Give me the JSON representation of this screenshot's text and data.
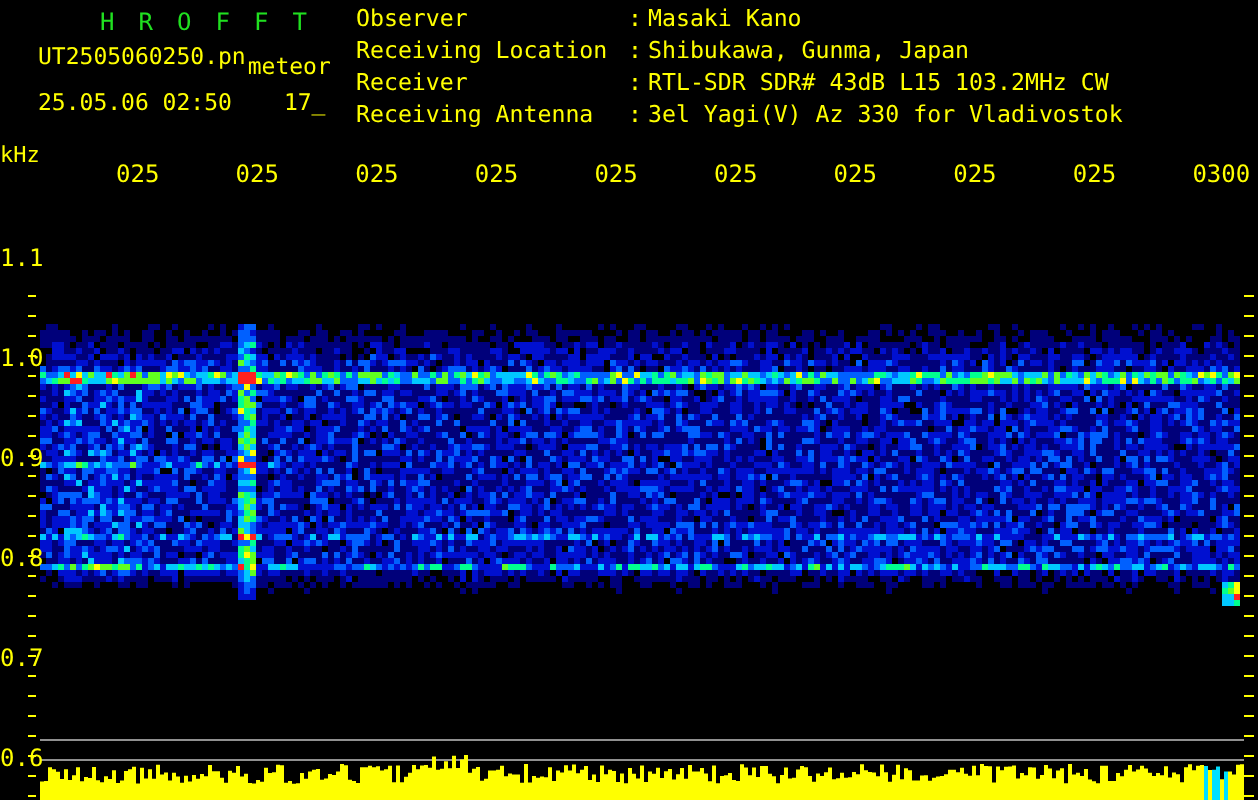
{
  "header": {
    "title": "H R O F F T",
    "file_name": "UT2505060250.pn",
    "tag": "meteor",
    "timestamp": "25.05.06 02:50",
    "counter": "17_"
  },
  "info": [
    {
      "label": "Observer",
      "separator": ":",
      "value": "Masaki Kano"
    },
    {
      "label": "Receiving Location",
      "separator": ":",
      "value": "Shibukawa, Gunma, Japan"
    },
    {
      "label": "Receiver",
      "separator": ":",
      "value": "RTL-SDR SDR# 43dB L15 103.2MHz CW"
    },
    {
      "label": "Receiving Antenna",
      "separator": ":",
      "value": "3el Yagi(V) Az 330 for Vladivostok"
    }
  ],
  "spectrogram": {
    "y_unit": "kHz",
    "time_labels": [
      "025",
      "025",
      "025",
      "025",
      "025",
      "025",
      "025",
      "025",
      "025",
      "0300"
    ],
    "frequency_labels": [
      "1.1",
      "1.0",
      "0.9",
      "0.8",
      "0.7",
      "0.6"
    ]
  }
}
